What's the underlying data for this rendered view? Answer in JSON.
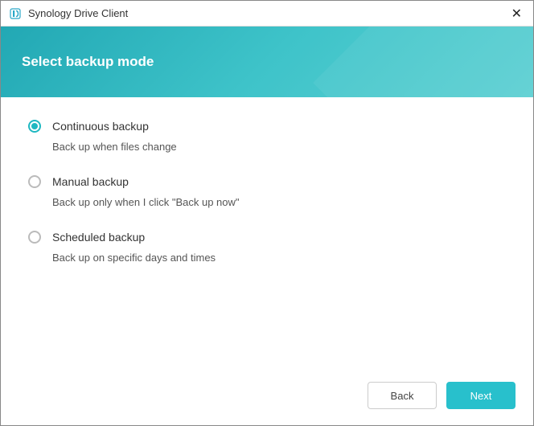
{
  "window": {
    "title": "Synology Drive Client"
  },
  "header": {
    "title": "Select backup mode"
  },
  "options": [
    {
      "id": "continuous",
      "label": "Continuous backup",
      "description": "Back up when files change",
      "selected": true
    },
    {
      "id": "manual",
      "label": "Manual backup",
      "description": "Back up only when I click \"Back up now\"",
      "selected": false
    },
    {
      "id": "scheduled",
      "label": "Scheduled backup",
      "description": "Back up on specific days and times",
      "selected": false
    }
  ],
  "footer": {
    "back_label": "Back",
    "next_label": "Next"
  }
}
